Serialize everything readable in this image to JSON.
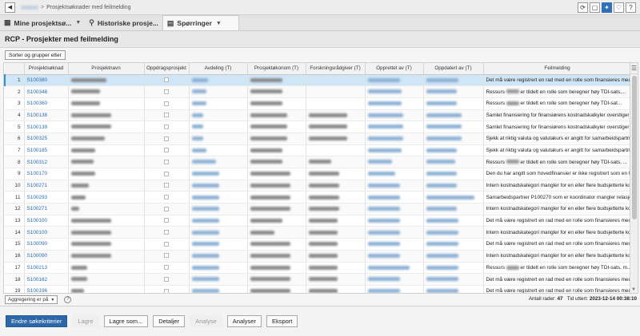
{
  "breadcrumb": {
    "separator": ">",
    "current": "Prosjektsøknader med feilmelding"
  },
  "top_icons": [
    {
      "name": "refresh-icon",
      "glyph": "⟳"
    },
    {
      "name": "layout-icon",
      "glyph": "▢"
    },
    {
      "name": "lightbulb-icon",
      "glyph": "✦"
    },
    {
      "name": "heart-icon",
      "glyph": "♡"
    },
    {
      "name": "help-icon",
      "glyph": "?"
    }
  ],
  "tabs": [
    {
      "label": "Mine prosjektsø...",
      "icon": "grid-icon",
      "glyph": "▦",
      "active": false,
      "has_caret": true
    },
    {
      "label": "Historiske prosje...",
      "icon": "search-icon",
      "glyph": "⚲",
      "active": false,
      "has_caret": false
    },
    {
      "label": "Spørringer",
      "icon": "query-icon",
      "glyph": "▤",
      "active": true,
      "has_caret": true
    }
  ],
  "page_title": "RCP - Prosjekter med feilmelding",
  "sort_button": "Sorter og grupper etter",
  "columns": [
    "",
    "Prosjektsøknad",
    "Prosjektnavn",
    "Oppdragsprosjekt",
    "Avdeling (T)",
    "Prosjektøkonom (T)",
    "Forskningsrådgiver (T)",
    "Opprettet av (T)",
    "Oppdatert av (T)",
    "Feilmelding"
  ],
  "rows": [
    {
      "n": "1",
      "app": "S100380",
      "name_w": 44,
      "dept_w": 20,
      "econ_w": 40,
      "adv_w": 0,
      "cre_w": 40,
      "upd_w": 40,
      "msg": "Det må være registrert en rad med en rolle som finansieres med rundsu...",
      "blur_msg": false,
      "msg_pre": "",
      "msg_post": "",
      "selected": true
    },
    {
      "n": "2",
      "app": "S100348",
      "name_w": 36,
      "dept_w": 18,
      "econ_w": 40,
      "adv_w": 0,
      "cre_w": 42,
      "upd_w": 38,
      "msg": "",
      "blur_msg": true,
      "msg_pre": "Ressurs",
      "msg_post": "er tildelt en rolle som beregner høy TDI-sats,...",
      "selected": false
    },
    {
      "n": "3",
      "app": "S100360",
      "name_w": 36,
      "dept_w": 18,
      "econ_w": 40,
      "adv_w": 0,
      "cre_w": 42,
      "upd_w": 38,
      "msg": "",
      "blur_msg": true,
      "msg_pre": "Ressurs",
      "msg_post": "er tildelt en rolle som beregner høy TDI-sat...",
      "selected": false
    },
    {
      "n": "4",
      "app": "S100138",
      "name_w": 50,
      "dept_w": 14,
      "econ_w": 46,
      "adv_w": 48,
      "cre_w": 44,
      "upd_w": 44,
      "msg": "Samlet finansiering for finansiørens kostnadskalkyler overstiger finansi...",
      "blur_msg": false,
      "msg_pre": "",
      "msg_post": "",
      "selected": false
    },
    {
      "n": "5",
      "app": "S100139",
      "name_w": 50,
      "dept_w": 14,
      "econ_w": 46,
      "adv_w": 48,
      "cre_w": 44,
      "upd_w": 44,
      "msg": "Samlet finansiering for finansiørens kostnadskalkyler overstiger finansi...",
      "blur_msg": false,
      "msg_pre": "",
      "msg_post": "",
      "selected": false
    },
    {
      "n": "6",
      "app": "S100325",
      "name_w": 42,
      "dept_w": 14,
      "econ_w": 46,
      "adv_w": 48,
      "cre_w": 44,
      "upd_w": 44,
      "msg": "Sjekk at riktig valuta og valutakurs er angitt for samarbeidspartnere.",
      "blur_msg": false,
      "msg_pre": "",
      "msg_post": "",
      "selected": false
    },
    {
      "n": "7",
      "app": "S100185",
      "name_w": 30,
      "dept_w": 18,
      "econ_w": 40,
      "adv_w": 0,
      "cre_w": 42,
      "upd_w": 38,
      "msg": "Sjekk at riktig valuta og valutakurs er angitt for samarbeidspartnere.",
      "blur_msg": false,
      "msg_pre": "",
      "msg_post": "",
      "selected": false
    },
    {
      "n": "8",
      "app": "S100312",
      "name_w": 28,
      "dept_w": 30,
      "econ_w": 40,
      "adv_w": 28,
      "cre_w": 30,
      "upd_w": 36,
      "msg": "",
      "blur_msg": true,
      "msg_pre": "Ressurs",
      "msg_post": "er tildelt en rolle som beregner høy TDI-sats, ...",
      "selected": false
    },
    {
      "n": "9",
      "app": "S100170",
      "name_w": 30,
      "dept_w": 34,
      "econ_w": 50,
      "adv_w": 38,
      "cre_w": 34,
      "upd_w": 38,
      "msg": "Den du har angitt som hovedfinansier er ikke registrert som en finansør...",
      "blur_msg": false,
      "msg_pre": "",
      "msg_post": "",
      "selected": false
    },
    {
      "n": "10",
      "app": "S100271",
      "name_w": 22,
      "dept_w": 34,
      "econ_w": 50,
      "adv_w": 38,
      "cre_w": 40,
      "upd_w": 38,
      "msg": "Intern kostnadskategori mangler for en eller flere budsjetterte kostnade...",
      "blur_msg": false,
      "msg_pre": "",
      "msg_post": "",
      "selected": false
    },
    {
      "n": "11",
      "app": "S100293",
      "name_w": 18,
      "dept_w": 34,
      "econ_w": 50,
      "adv_w": 38,
      "cre_w": 40,
      "upd_w": 60,
      "msg": "Samarbeidspartner P100270 som er koordinator mangler relasjon mo...",
      "blur_msg": false,
      "msg_pre": "",
      "msg_post": "",
      "selected": false
    },
    {
      "n": "12",
      "app": "S100271",
      "name_w": 10,
      "dept_w": 34,
      "econ_w": 50,
      "adv_w": 38,
      "cre_w": 40,
      "upd_w": 38,
      "msg": "Intern kostnadskategori mangler for en eller flere budsjetterte kostnade...",
      "blur_msg": false,
      "msg_pre": "",
      "msg_post": "",
      "selected": false
    },
    {
      "n": "13",
      "app": "S100100",
      "name_w": 50,
      "dept_w": 34,
      "econ_w": 40,
      "adv_w": 36,
      "cre_w": 40,
      "upd_w": 40,
      "msg": "Det må være registrert en rad med en rolle som finansieres med rundsu...",
      "blur_msg": false,
      "msg_pre": "",
      "msg_post": "",
      "selected": false
    },
    {
      "n": "14",
      "app": "S100100",
      "name_w": 50,
      "dept_w": 34,
      "econ_w": 30,
      "adv_w": 36,
      "cre_w": 40,
      "upd_w": 40,
      "msg": "Intern kostnadskategori mangler for en eller flere budsjetterte kostnade...",
      "blur_msg": false,
      "msg_pre": "",
      "msg_post": "",
      "selected": false
    },
    {
      "n": "15",
      "app": "S100090",
      "name_w": 50,
      "dept_w": 34,
      "econ_w": 50,
      "adv_w": 36,
      "cre_w": 40,
      "upd_w": 40,
      "msg": "Det må være registrert en rad med en rolle som finansieres med rundsu...",
      "blur_msg": false,
      "msg_pre": "",
      "msg_post": "",
      "selected": false
    },
    {
      "n": "16",
      "app": "S100090",
      "name_w": 50,
      "dept_w": 34,
      "econ_w": 50,
      "adv_w": 36,
      "cre_w": 40,
      "upd_w": 40,
      "msg": "Intern kostnadskategori mangler for en eller flere budsjetterte kostnade...",
      "blur_msg": false,
      "msg_pre": "",
      "msg_post": "",
      "selected": false
    },
    {
      "n": "17",
      "app": "S100213",
      "name_w": 20,
      "dept_w": 34,
      "econ_w": 50,
      "adv_w": 36,
      "cre_w": 52,
      "upd_w": 40,
      "msg": "",
      "blur_msg": true,
      "msg_pre": "Ressurs",
      "msg_post": "er tildelt en rolle som beregner høy TDI-sats, m...",
      "selected": false
    },
    {
      "n": "18",
      "app": "S100162",
      "name_w": 20,
      "dept_w": 34,
      "econ_w": 50,
      "adv_w": 36,
      "cre_w": 40,
      "upd_w": 40,
      "msg": "Det må være registrert en rad med en rolle som finansieres med rundsu...",
      "blur_msg": false,
      "msg_pre": "",
      "msg_post": "",
      "selected": false
    },
    {
      "n": "19",
      "app": "S100196",
      "name_w": 16,
      "dept_w": 34,
      "econ_w": 50,
      "adv_w": 36,
      "cre_w": 40,
      "upd_w": 40,
      "msg": "Det må være registrert en rad med en rolle som finansieres med rundsu...",
      "blur_msg": false,
      "msg_pre": "",
      "msg_post": "",
      "selected": false
    }
  ],
  "aggregation_label": "Aggregering er på",
  "stats": {
    "rows_label": "Antall rader:",
    "rows_value": "47",
    "time_label": "Tid uttert:",
    "time_value": "2023-12-14 00:38:10"
  },
  "buttons": [
    {
      "name": "change-criteria-button",
      "label": "Endre søkekriterier",
      "style": "primary"
    },
    {
      "name": "save-button",
      "label": "Lagre",
      "style": "disabled"
    },
    {
      "name": "save-as-button",
      "label": "Lagre som...",
      "style": "normal"
    },
    {
      "name": "details-button",
      "label": "Detaljer",
      "style": "normal"
    },
    {
      "name": "analyze-button",
      "label": "Analyse",
      "style": "disabled"
    },
    {
      "name": "analyses-button",
      "label": "Analyser",
      "style": "normal"
    },
    {
      "name": "export-button",
      "label": "Eksport",
      "style": "normal"
    }
  ]
}
